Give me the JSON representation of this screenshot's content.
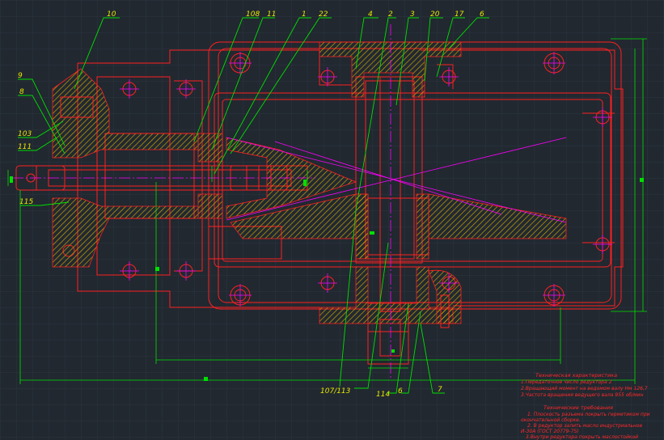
{
  "drawing": {
    "callouts": {
      "c10": "10",
      "c108": "108",
      "c11": "11",
      "c1": "1",
      "c22": "22",
      "c4": "4",
      "c2": "2",
      "c3": "3",
      "c20": "20",
      "c17": "17",
      "c6top": "6",
      "c9": "9",
      "c8": "8",
      "c103": "103",
      "c111": "111",
      "c115": "115",
      "c107": "107/113",
      "c114": "114",
      "c6bot": "6",
      "c7": "7"
    },
    "tech_char": {
      "title": "Техническая характеристика",
      "lines": [
        "1.Передаточное число редуктора 2",
        "2.Вращающий момент на ведомом валу Нм 126,7",
        "3.Частота вращения ведущего вала 955 об/мин"
      ]
    },
    "tech_req": {
      "title": "Технические требования",
      "lines": [
        "1. Плоскость разъема покрыть герметиком при",
        "окончательной сборке.",
        "2. В редуктор залить масло индустриальное",
        "И-30А (ГОСТ 20779-75)",
        "3.Внутри редуктора покрыть маслостойкой"
      ]
    },
    "colors": {
      "background": "#212830",
      "grid": "#2b3440",
      "body": "#ff2020",
      "hatch": "#c8a000",
      "leader": "#00e000",
      "dimension": "#00e000",
      "axis": "#ff00ff",
      "text": "#e6e600",
      "notes": "#ff2a2a"
    }
  }
}
